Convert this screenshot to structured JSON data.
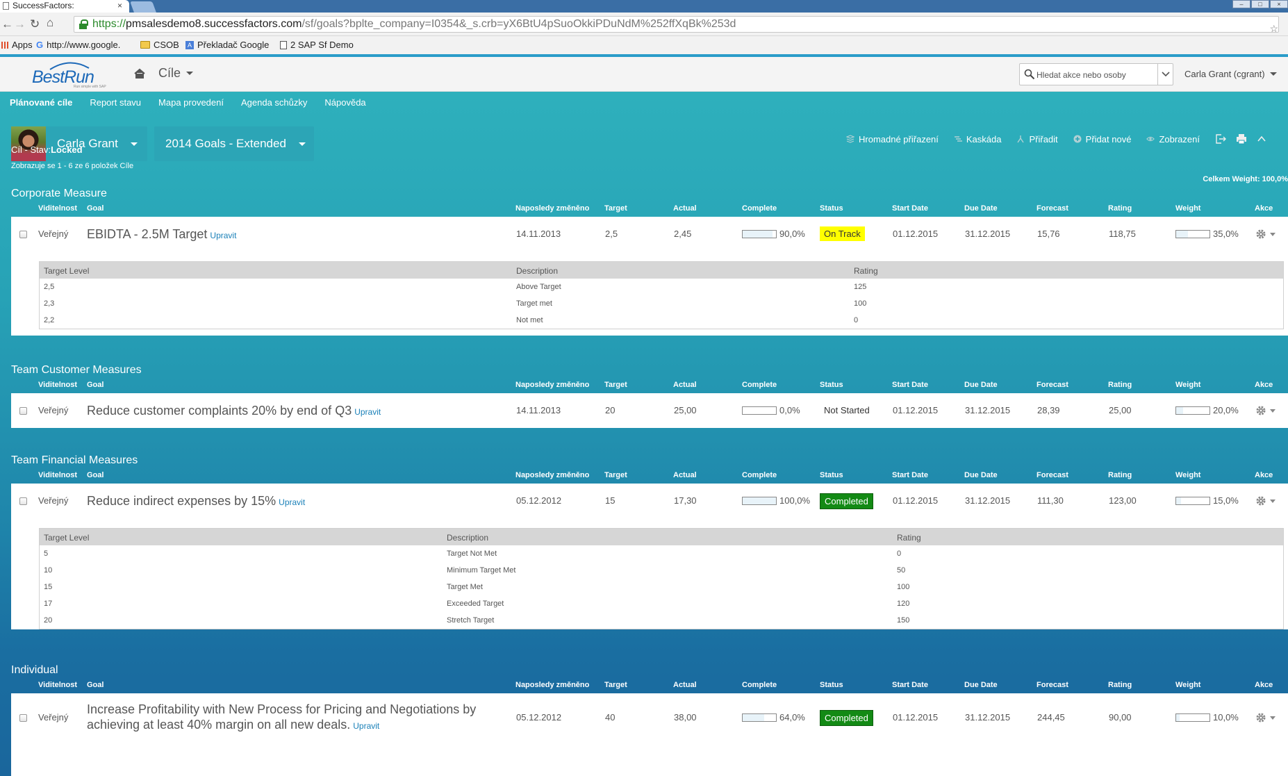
{
  "browser": {
    "tab_title": "SuccessFactors:",
    "tab_close": "×",
    "url_scheme": "https://",
    "url_host": "pmsalesdemo8.successfactors.com",
    "url_path": "/sf/goals?bplte_company=I0354&_s.crb=yX6BtU4pSuoOkkiPDuNdM%252ffXqBk%253d",
    "bookmarks": [
      "Apps",
      "http://www.google.",
      "CSOB",
      "Překladač Google",
      "2 SAP Sf Demo"
    ]
  },
  "header": {
    "logo_text": "BestRun",
    "logo_sub": "Run simple with SAP",
    "module_label": "Cíle",
    "search_placeholder": "Hledat akce nebo osoby",
    "user_label": "Carla Grant (cgrant)"
  },
  "subnav": [
    "Plánované cíle",
    "Report stavu",
    "Mapa provedení",
    "Agenda schůzky",
    "Nápověda"
  ],
  "owner": {
    "name": "Carla Grant"
  },
  "plan": {
    "name": "2014 Goals - Extended"
  },
  "toolbar": [
    "Hromadné přiřazení",
    "Kaskáda",
    "Přiřadit",
    "Přidat nové",
    "Zobrazení"
  ],
  "state": {
    "prefix": "Cíl - Stav:",
    "value": "Locked"
  },
  "count_text": "Zobrazuje se 1 - 6 ze 6 položek Cíle",
  "total_weight": "Celkem Weight: 100,0%",
  "columns": [
    "Viditelnost",
    "Goal",
    "Naposledy změněno",
    "Target",
    "Actual",
    "Complete",
    "Status",
    "Start Date",
    "Due Date",
    "Forecast",
    "Rating",
    "Weight",
    "Akce"
  ],
  "sections": [
    {
      "title": "Corporate Measure",
      "goal": {
        "visibility": "Veřejný",
        "name": "EBIDTA - 2.5M Target",
        "edit": "Upravit",
        "modified": "14.11.2013",
        "target": "2,5",
        "actual": "2,45",
        "complete_pct": 90,
        "complete": "90,0%",
        "status": "On Track",
        "start": "01.12.2015",
        "due": "31.12.2015",
        "forecast": "15,76",
        "rating": "118,75",
        "weight_pct": 35,
        "weight": "35,0%"
      },
      "levels_header": [
        "Target Level",
        "Description",
        "Rating"
      ],
      "levels": [
        [
          "2,5",
          "Above Target",
          "125"
        ],
        [
          "2,3",
          "Target met",
          "100"
        ],
        [
          "2,2",
          "Not met",
          "0"
        ]
      ]
    },
    {
      "title": "Team Customer Measures",
      "goal": {
        "visibility": "Veřejný",
        "name": "Reduce customer complaints 20% by end of Q3",
        "edit": "Upravit",
        "modified": "14.11.2013",
        "target": "20",
        "actual": "25,00",
        "complete_pct": 0,
        "complete": "0,0%",
        "status": "Not Started",
        "start": "01.12.2015",
        "due": "31.12.2015",
        "forecast": "28,39",
        "rating": "25,00",
        "weight_pct": 20,
        "weight": "20,0%"
      }
    },
    {
      "title": "Team Financial Measures",
      "goal": {
        "visibility": "Veřejný",
        "name": "Reduce indirect expenses by 15%",
        "edit": "Upravit",
        "modified": "05.12.2012",
        "target": "15",
        "actual": "17,30",
        "complete_pct": 100,
        "complete": "100,0%",
        "status": "Completed",
        "start": "01.12.2015",
        "due": "31.12.2015",
        "forecast": "111,30",
        "rating": "123,00",
        "weight_pct": 15,
        "weight": "15,0%"
      },
      "levels_header": [
        "Target Level",
        "Description",
        "Rating"
      ],
      "levels": [
        [
          "5",
          "Target Not Met",
          "0"
        ],
        [
          "10",
          "Minimum Target Met",
          "50"
        ],
        [
          "15",
          "Target Met",
          "100"
        ],
        [
          "17",
          "Exceeded Target",
          "120"
        ],
        [
          "20",
          "Stretch Target",
          "150"
        ]
      ]
    },
    {
      "title": "Individual",
      "goal": {
        "visibility": "Veřejný",
        "name_line1": "Increase Profitability with New Process for Pricing and Negotiations by",
        "name_line2": "achieving at least 40% margin on all new deals.",
        "edit": "Upravit",
        "modified": "05.12.2012",
        "target": "40",
        "actual": "38,00",
        "complete_pct": 64,
        "complete": "64,0%",
        "status": "Completed",
        "start": "01.12.2015",
        "due": "31.12.2015",
        "forecast": "244,45",
        "rating": "90,00",
        "weight_pct": 10,
        "weight": "10,0%"
      }
    }
  ],
  "colors": {
    "on_track": "#ffff00",
    "completed": "#138a15",
    "teal": "#2eb0bc",
    "link": "#1a80b8"
  }
}
